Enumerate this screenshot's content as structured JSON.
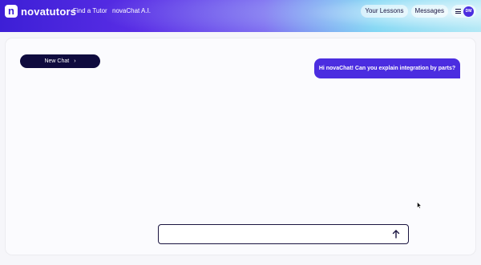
{
  "header": {
    "logo_glyph": "n",
    "logo_text": "novatutors",
    "nav": [
      "Find a Tutor",
      "novaChat A.I."
    ],
    "pills": [
      "Your Lessons",
      "Messages"
    ],
    "avatar_initials": "DM",
    "menu_icon": "hamburger-icon"
  },
  "chat": {
    "new_chat_label": "New Chat",
    "new_chat_icon": "chevron-right-icon",
    "user_message": "Hi novaChat! Can you explain integration by parts?",
    "input_value": "",
    "input_placeholder": "",
    "send_icon": "arrow-up-icon"
  },
  "colors": {
    "brand": "#3d1fd6",
    "accent": "#4b2de0",
    "dark": "#0f0b3e"
  }
}
